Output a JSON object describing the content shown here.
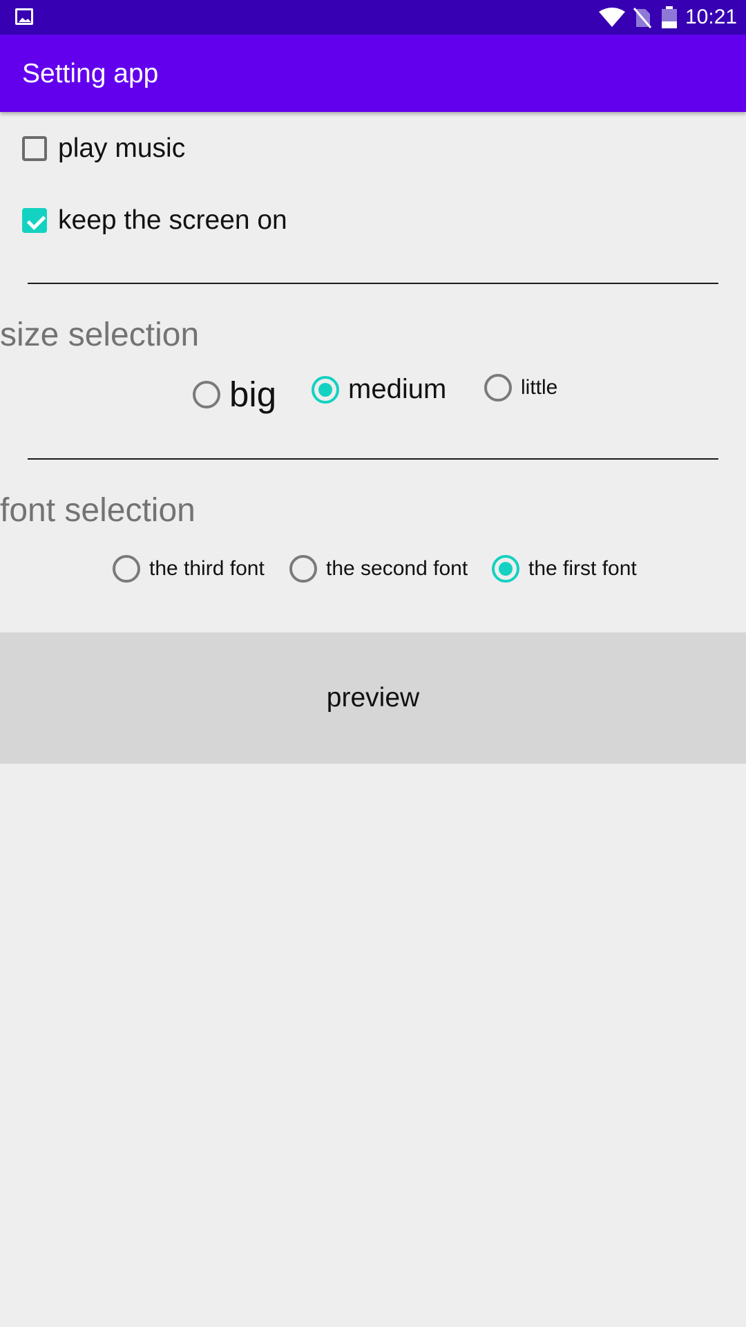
{
  "status_bar": {
    "time": "10:21",
    "icons": [
      "gallery-icon",
      "wifi-icon",
      "no-sim-icon",
      "battery-icon"
    ]
  },
  "app_bar": {
    "title": "Setting app"
  },
  "checkboxes": [
    {
      "label": "play music",
      "checked": false
    },
    {
      "label": "keep the screen on",
      "checked": true
    }
  ],
  "size_section": {
    "title": "size selection",
    "options": [
      {
        "label": "big",
        "selected": false
      },
      {
        "label": "medium",
        "selected": true
      },
      {
        "label": "little",
        "selected": false
      }
    ]
  },
  "font_section": {
    "title": "font selection",
    "options": [
      {
        "label": "the third font",
        "selected": false
      },
      {
        "label": "the second font",
        "selected": false
      },
      {
        "label": "the first font",
        "selected": true
      }
    ]
  },
  "preview_button": {
    "label": "preview"
  },
  "colors": {
    "status_bar": "#3700b3",
    "app_bar": "#6200ee",
    "accent": "#14d2c1",
    "background": "#eeeeee",
    "button": "#d6d6d6"
  }
}
